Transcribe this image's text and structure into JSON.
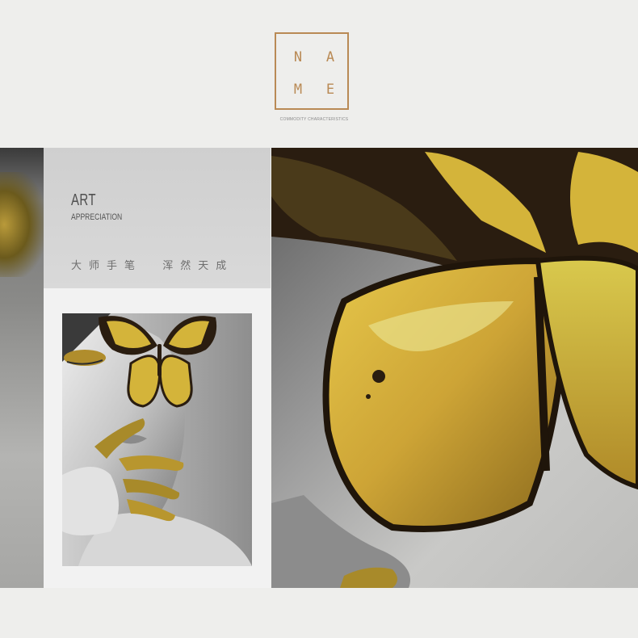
{
  "logo": {
    "letters": [
      "N",
      "A",
      "M",
      "E"
    ],
    "caption": "COMMODITY CHARACTERISTICS",
    "color": "#b98a55"
  },
  "panel": {
    "title": "ART",
    "subtitle": "APPRECIATION",
    "slogan": "大师手笔  浑然天成"
  },
  "colors": {
    "accent_gold": "#b98a55",
    "butterfly_yellow": "#d4b43a",
    "butterfly_dark": "#2a1d10"
  }
}
